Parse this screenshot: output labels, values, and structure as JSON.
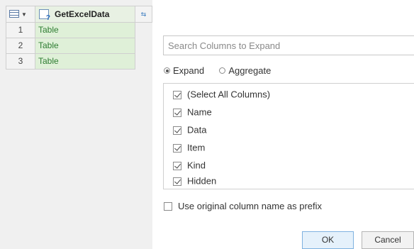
{
  "grid": {
    "column_header": "GetExcelData",
    "rows": [
      {
        "num": "1",
        "value": "Table"
      },
      {
        "num": "2",
        "value": "Table"
      },
      {
        "num": "3",
        "value": "Table"
      }
    ]
  },
  "icons": {
    "table_menu": "table-icon",
    "column_type": "any-type-icon",
    "expand": "expand-column-icon"
  },
  "expand_dialog": {
    "search_placeholder": "Search Columns to Expand",
    "radio_expand": "Expand",
    "radio_aggregate": "Aggregate",
    "selected_mode": "Expand",
    "columns": [
      {
        "label": "(Select All Columns)",
        "checked": true
      },
      {
        "label": "Name",
        "checked": true
      },
      {
        "label": "Data",
        "checked": true
      },
      {
        "label": "Item",
        "checked": true
      },
      {
        "label": "Kind",
        "checked": true
      },
      {
        "label": "Hidden",
        "checked": true
      }
    ],
    "prefix_label": "Use original column name as prefix",
    "prefix_checked": false,
    "ok_label": "OK",
    "cancel_label": "Cancel"
  },
  "colors": {
    "cell_text": "#2e7d32",
    "cell_bg": "#dff0d8",
    "ok_border": "#7fb2e0"
  }
}
